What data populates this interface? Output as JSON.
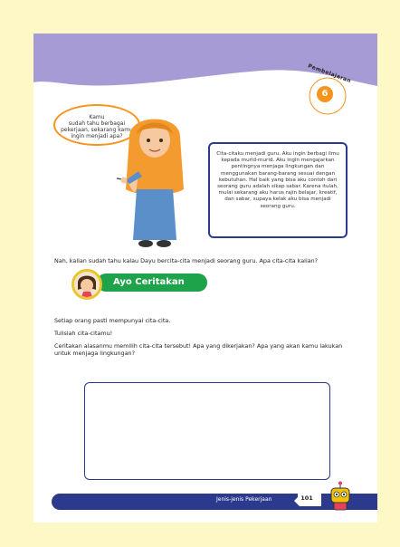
{
  "header": {
    "lesson_word": "Pembelajaran",
    "lesson_number": "6"
  },
  "bubble_left": {
    "lines": [
      "Kamu",
      "sudah tahu berbagai",
      "pekerjaan, sekarang kamu",
      "ingin menjadi apa?"
    ]
  },
  "bubble_right": {
    "text": "Cita-citaku menjadi guru. Aku ingin berbagi ilmu kepada murid-murid. Aku ingin mengajarkan pentingnya menjaga lingkungan dan menggunakan barang-barang sesuai dengan kebutuhan. Hal baik yang bisa aku contoh dari seorang guru adalah sikap sabar. Karena itulah, mulai sekarang aku harus rajin belajar, kreatif, dan sabar, supaya kelak aku bisa menjadi seorang guru."
  },
  "intro": "Nah, kalian sudah tahu kalau Dayu bercita-cita menjadi seorang guru. Apa cita-cita kalian?",
  "section": {
    "title": "Ayo Ceritakan"
  },
  "paragraphs": [
    "Setiap orang pasti mempunyai cita-cita.",
    "Tulislah cita-citamu!",
    "Ceritakan alasanmu memilih cita-cita tersebut! Apa yang dikerjakan? Apa yang akan kamu lakukan untuk menjaga  lingkungan?"
  ],
  "footer": {
    "chapter": "Jenis-jenis Pekerjaan",
    "page_number": "101"
  },
  "colors": {
    "page_background": "#fdf8c6",
    "header": "#a79bd6",
    "accent_orange": "#f7941d",
    "accent_green": "#1fa34a",
    "navy": "#2b3a8c"
  }
}
